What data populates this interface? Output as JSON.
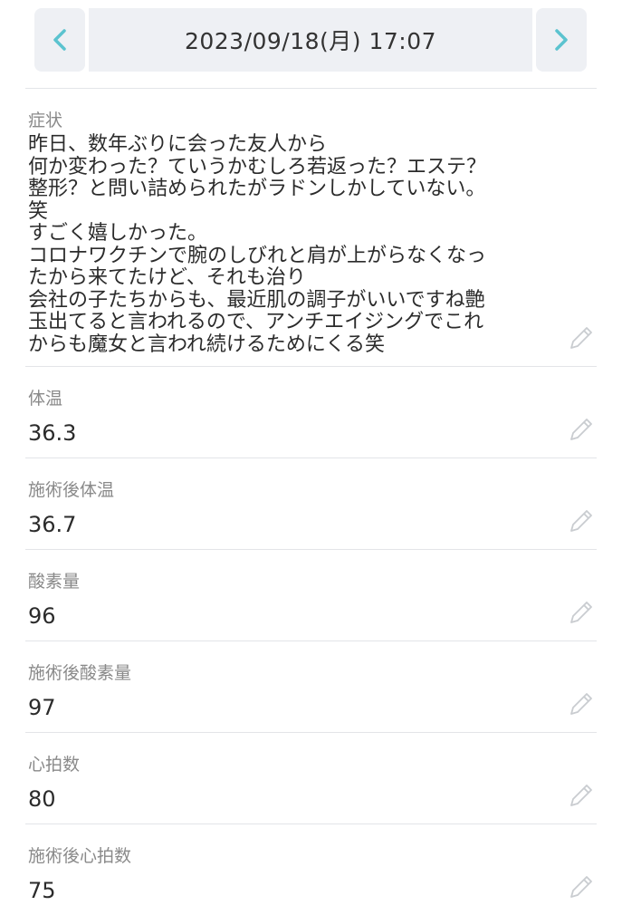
{
  "header": {
    "prev_icon": "chevron-left-icon",
    "next_icon": "chevron-right-icon",
    "datetime": "2023/09/18(月) 17:07",
    "accent_color": "#5bc3cf"
  },
  "records": [
    {
      "label": "症状",
      "value": "昨日、数年ぶりに会った友人から\n何か変わった？ていうかむしろ若返った？エステ？\n整形？と問い詰められたがラドンしかしていない。\n笑\nすごく嬉しかった。\nコロナワクチンで腕のしびれと肩が上がらなくなっ\nたから来てたけど、それも治り\n会社の子たちからも、最近肌の調子がいいですね艶\n玉出てると言われるので、アンチエイジングでこれ\nからも魔女と言われ続けるためにくる笑"
    },
    {
      "label": "体温",
      "value": "36.3"
    },
    {
      "label": "施術後体温",
      "value": "36.7"
    },
    {
      "label": "酸素量",
      "value": "96"
    },
    {
      "label": "施術後酸素量",
      "value": "97"
    },
    {
      "label": "心拍数",
      "value": "80"
    },
    {
      "label": "施術後心拍数",
      "value": "75"
    }
  ],
  "edit_icon": "pencil-icon"
}
